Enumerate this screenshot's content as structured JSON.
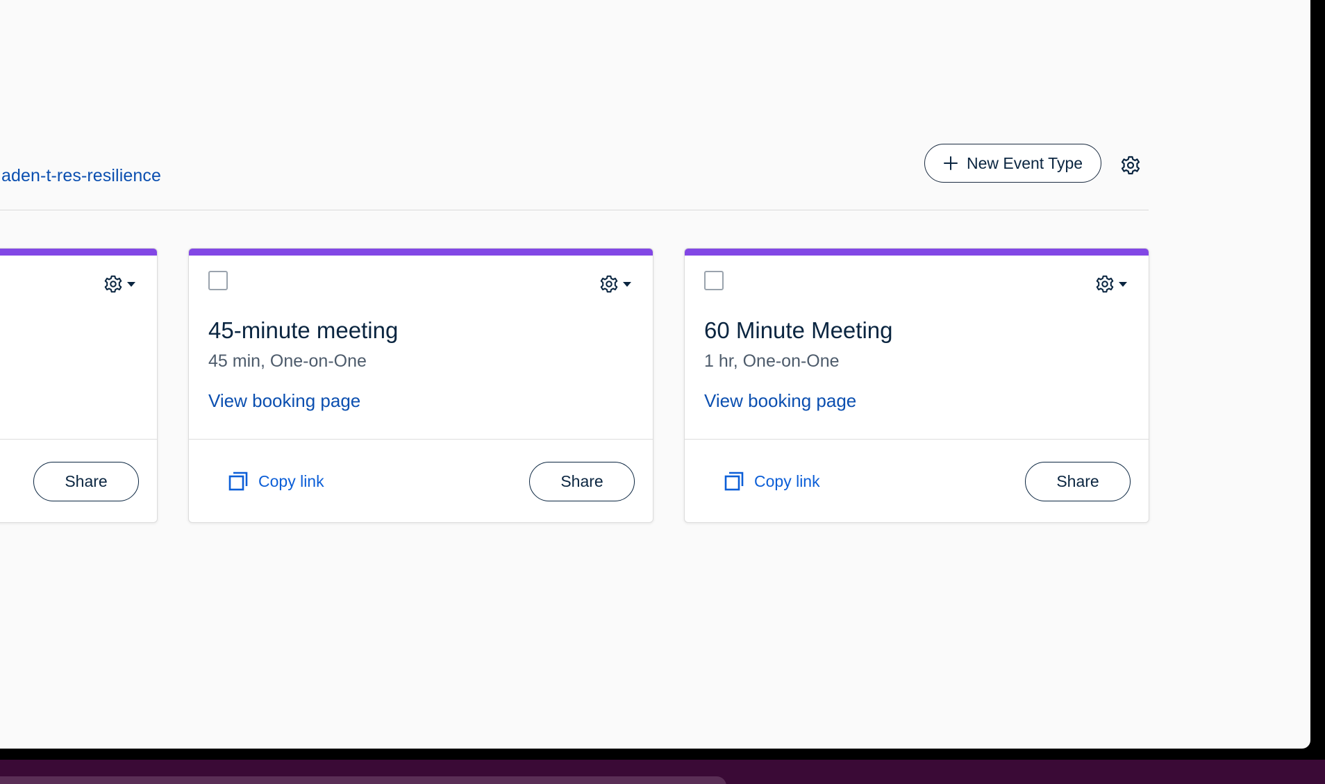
{
  "header": {
    "slug_link": "aden-t-res-resilience",
    "new_event_label": "New Event Type"
  },
  "cards": [
    {
      "title": "",
      "subtitle": "",
      "view_link": "",
      "copy_link": "",
      "share": "Share",
      "accent": "#8247e5"
    },
    {
      "title": "45-minute meeting",
      "subtitle": "45 min, One-on-One",
      "view_link": "View booking page",
      "copy_link": "Copy link",
      "share": "Share",
      "accent": "#8247e5"
    },
    {
      "title": "60 Minute Meeting",
      "subtitle": "1 hr, One-on-One",
      "view_link": "View booking page",
      "copy_link": "Copy link",
      "share": "Share",
      "accent": "#8247e5"
    }
  ],
  "icons": {
    "plus": "plus-icon",
    "gear": "gear-icon",
    "caret": "caret-down-icon",
    "copy": "copy-icon"
  },
  "colors": {
    "accent": "#8247e5",
    "link": "#0b4fb0",
    "text": "#0a2540",
    "muted": "#4d5b6b"
  }
}
